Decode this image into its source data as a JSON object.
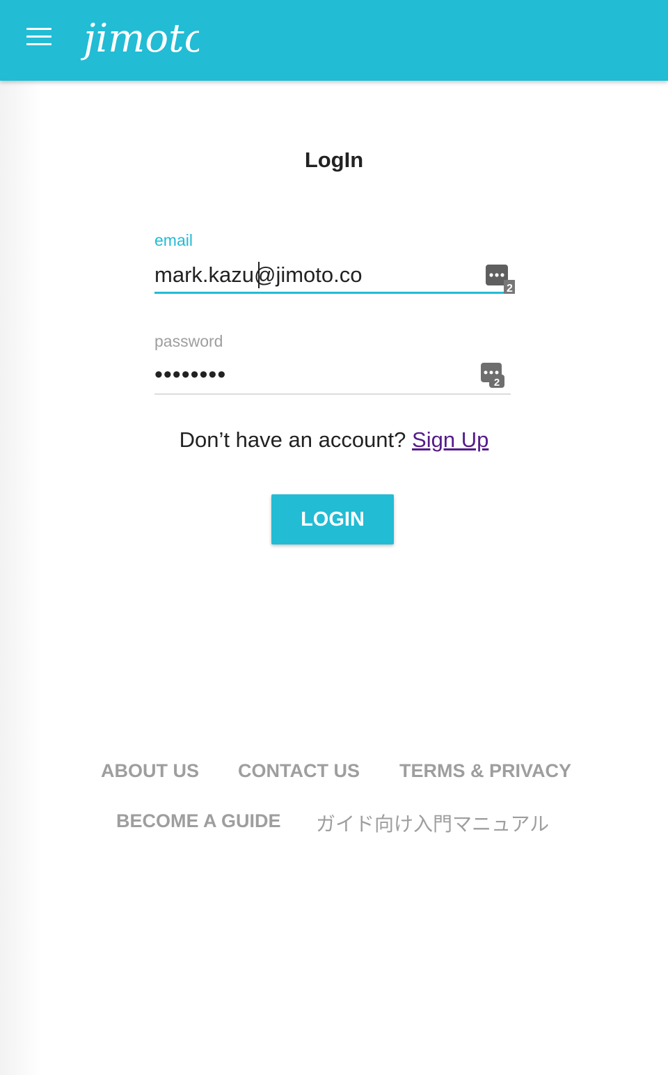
{
  "header": {
    "menu_icon": "hamburger-menu-icon",
    "logo_text": "jimoto"
  },
  "page": {
    "title": "LogIn"
  },
  "form": {
    "email_label": "email",
    "email_value": "mark.kazu@jimoto.co",
    "password_label": "password",
    "password_value": "masked8x",
    "password_manager_icon": "password-manager-icon",
    "password_manager_badge": "2"
  },
  "signup": {
    "prompt": "Don’t have an account?",
    "link_text": "Sign Up"
  },
  "login_button": {
    "label": "LOGIN"
  },
  "footer": {
    "about": "ABOUT US",
    "contact": "CONTACT US",
    "terms": "TERMS & PRIVACY",
    "guide": "BECOME A GUIDE",
    "manual": "ガイド向け入門マニュアル"
  },
  "colors": {
    "accent": "#22bcd4",
    "link_visited": "#551a8b",
    "footer_text": "#9e9e9e"
  }
}
